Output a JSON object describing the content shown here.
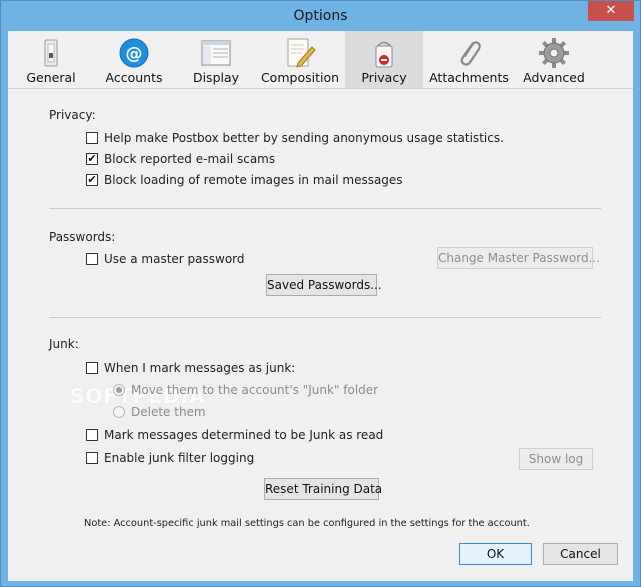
{
  "window": {
    "title": "Options",
    "close_glyph": "✕"
  },
  "tabs": [
    {
      "label": "General",
      "icon": "switch-icon"
    },
    {
      "label": "Accounts",
      "icon": "at-icon"
    },
    {
      "label": "Display",
      "icon": "display-icon"
    },
    {
      "label": "Composition",
      "icon": "composition-icon"
    },
    {
      "label": "Privacy",
      "icon": "privacy-icon",
      "selected": true
    },
    {
      "label": "Attachments",
      "icon": "paperclip-icon"
    },
    {
      "label": "Advanced",
      "icon": "gear-icon"
    }
  ],
  "privacy": {
    "heading": "Privacy:",
    "usage_stats": {
      "label": "Help make Postbox better by sending anonymous usage statistics.",
      "checked": false
    },
    "block_scams": {
      "label": "Block reported e-mail scams",
      "checked": true
    },
    "block_remote_images": {
      "label": "Block loading of remote images in mail messages",
      "checked": true
    }
  },
  "passwords": {
    "heading": "Passwords:",
    "master_password": {
      "label": "Use a master password",
      "checked": false
    },
    "change_master_button": "Change Master Password...",
    "saved_passwords_button": "Saved Passwords..."
  },
  "junk": {
    "heading": "Junk:",
    "when_mark_junk": {
      "label": "When I mark messages as junk:",
      "checked": false
    },
    "move_to_junk": {
      "label": "Move them to the account's \"Junk\" folder",
      "selected": true
    },
    "delete_them": {
      "label": "Delete them",
      "selected": false
    },
    "mark_as_read": {
      "label": "Mark messages determined to be Junk as read",
      "checked": false
    },
    "junk_logging": {
      "label": "Enable junk filter logging",
      "checked": false
    },
    "show_log_button": "Show log",
    "reset_training_button": "Reset Training Data",
    "note": "Note: Account-specific junk mail settings can be configured in the settings for the account."
  },
  "footer": {
    "ok_label": "OK",
    "cancel_label": "Cancel"
  },
  "watermark": "SOFTPEDIA",
  "colors": {
    "titlebar": "#6fb2e3",
    "close": "#c7504b",
    "accent": "#3a8ad8"
  }
}
